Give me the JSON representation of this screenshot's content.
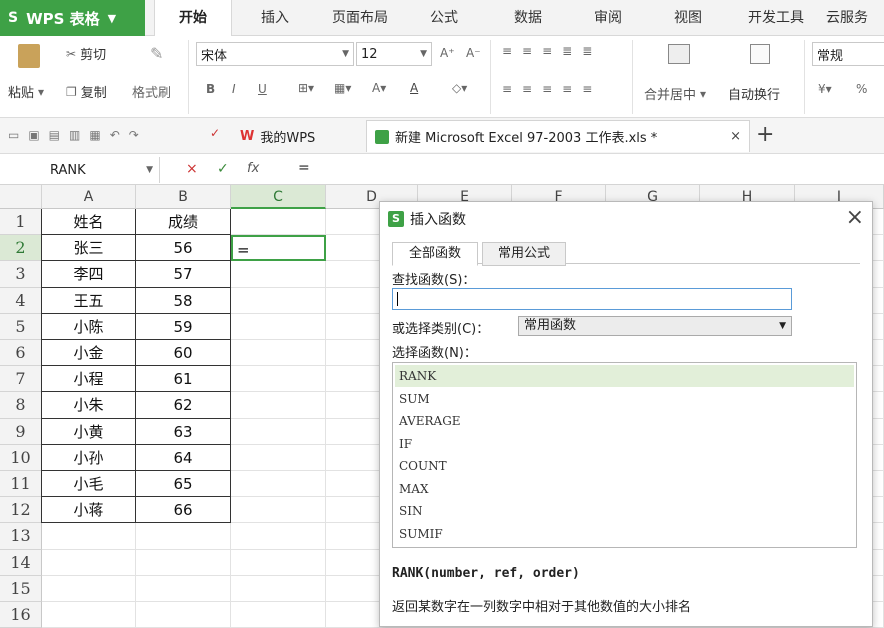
{
  "app": {
    "logo_label": "WPS 表格",
    "logo_s": "S"
  },
  "menu_tabs": [
    "开始",
    "插入",
    "页面布局",
    "公式",
    "数据",
    "审阅",
    "视图",
    "开发工具",
    "云服务"
  ],
  "ribbon": {
    "paste": "粘贴",
    "cut": "剪切",
    "copy": "复制",
    "format_painter": "格式刷",
    "font_name": "宋体",
    "font_size": "12",
    "merge_center": "合并居中",
    "wrap_text": "自动换行",
    "number_format": "常规",
    "pct": "%",
    "bold": "B",
    "italic": "I",
    "underline": "U",
    "font_color_a": "A"
  },
  "doc_tabs": {
    "home": "我的WPS",
    "file": "新建 Microsoft Excel 97-2003 工作表.xls *",
    "add": "+"
  },
  "formula": {
    "name_box": "RANK",
    "cancel": "×",
    "confirm": "✓",
    "fx": "fx",
    "content": "="
  },
  "sheet": {
    "columns": [
      "A",
      "B",
      "C",
      "D",
      "E",
      "F",
      "G",
      "H",
      "I"
    ],
    "rows": [
      "1",
      "2",
      "3",
      "4",
      "5",
      "6",
      "7",
      "8",
      "9",
      "10",
      "11",
      "12",
      "13",
      "14",
      "15",
      "16"
    ],
    "header": [
      "姓名",
      "成绩"
    ],
    "names": [
      "张三",
      "李四",
      "王五",
      "小陈",
      "小金",
      "小程",
      "小朱",
      "小黄",
      "小孙",
      "小毛",
      "小蒋"
    ],
    "scores": [
      "56",
      "57",
      "58",
      "59",
      "60",
      "61",
      "62",
      "63",
      "64",
      "65",
      "66"
    ],
    "active_cell_value": "="
  },
  "dialog": {
    "title": "插入函数",
    "close": "×",
    "logo": "S",
    "tabs": [
      "全部函数",
      "常用公式"
    ],
    "search_label": "查找函数(S)：",
    "search_value": "",
    "category_label": "或选择类别(C)：",
    "category_value": "常用函数",
    "list_label": "选择函数(N)：",
    "functions": [
      "RANK",
      "SUM",
      "AVERAGE",
      "IF",
      "COUNT",
      "MAX",
      "SIN",
      "SUMIF"
    ],
    "signature": "RANK(number, ref, order)",
    "description": "返回某数字在一列数字中相对于其他数值的大小排名"
  }
}
